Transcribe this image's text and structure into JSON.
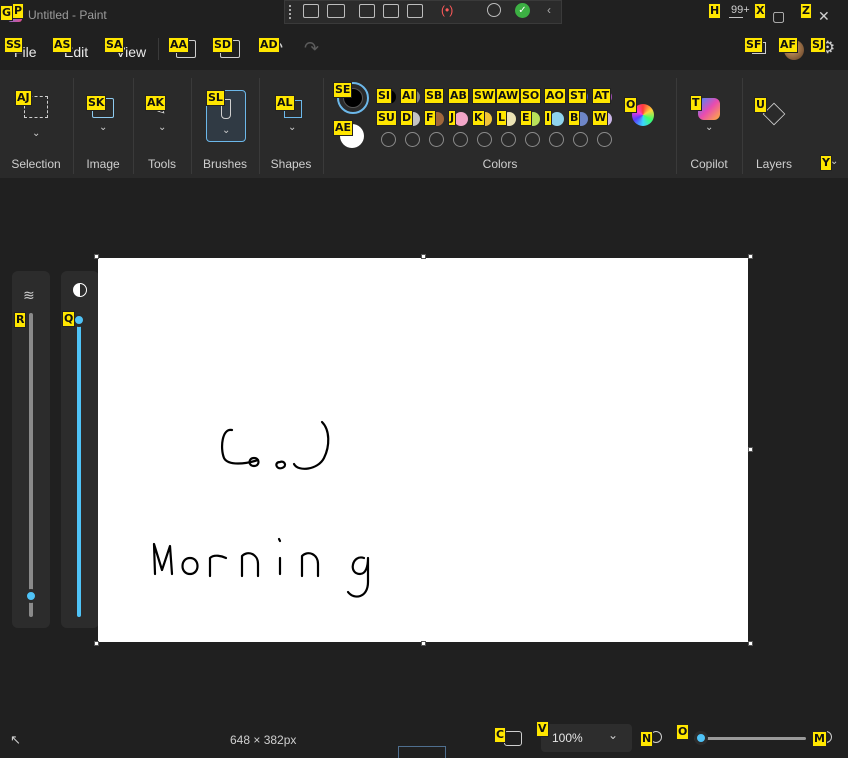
{
  "window": {
    "title": "Untitled - Paint",
    "notification_count": "99+",
    "controls": {
      "minimize": "—",
      "maximize": "▢",
      "close": "✕"
    }
  },
  "menu": {
    "file": "File",
    "edit": "Edit",
    "view": "View"
  },
  "ribbon": {
    "groups": {
      "selection": "Selection",
      "image": "Image",
      "tools": "Tools",
      "brushes": "Brushes",
      "shapes": "Shapes",
      "colors": "Colors",
      "copilot": "Copilot",
      "layers": "Layers"
    },
    "colors": {
      "color1": "#000000",
      "color2": "#ffffff",
      "row1": [
        "#000000",
        "#7f7f7f",
        "#c0282e",
        "#e83b3b",
        "#f58a1e",
        "#f5d31e",
        "#2aa84a",
        "#1e9ee8",
        "#3c50c8",
        "#a04bb4"
      ],
      "row2": [
        "#ffffff",
        "#c3c3c3",
        "#a0673c",
        "#f2a6c8",
        "#f0c43a",
        "#ece3b4",
        "#b8e05a",
        "#8fd3ee",
        "#6e86c8",
        "#c8b4e6"
      ]
    }
  },
  "hint_keys": {
    "app": "G",
    "paint": "P",
    "minimize": "H",
    "maximize": "X",
    "close": "Z",
    "file": "SS",
    "edit": "AS",
    "view": "SA",
    "save": "AA",
    "share": "SD",
    "undo": "AD",
    "selection": "AJ",
    "image": "SK",
    "tools": "AK",
    "brushes": "SL",
    "shapes": "AL",
    "color1": "SE",
    "color2": "AE",
    "row1": [
      "SI",
      "AI",
      "SB",
      "AB",
      "SW",
      "AW",
      "SO",
      "AO",
      "ST",
      "AT"
    ],
    "row2": [
      "SU",
      "D",
      "F",
      "J",
      "K",
      "L",
      "E",
      "I",
      "B",
      "W"
    ],
    "edit_colors": "O",
    "copilot": "T",
    "layers": "U",
    "collapse": "Y",
    "signin": "SF",
    "avatar": "AF",
    "settings": "SJ",
    "size_slider": "R",
    "opacity_slider": "Q",
    "fit": "C",
    "zoom_select": "V",
    "zoom_out": "N",
    "zoom_slider": "O",
    "zoom_in": "M"
  },
  "status": {
    "canvas_size": "648 × 382px",
    "zoom": "100%"
  },
  "sliders": {
    "brush_size_fraction": 0.05,
    "opacity_fraction": 1.0,
    "zoom_fraction": 0.0
  },
  "canvas": {
    "drawing_lines": [
      "Good",
      "Morning"
    ]
  }
}
